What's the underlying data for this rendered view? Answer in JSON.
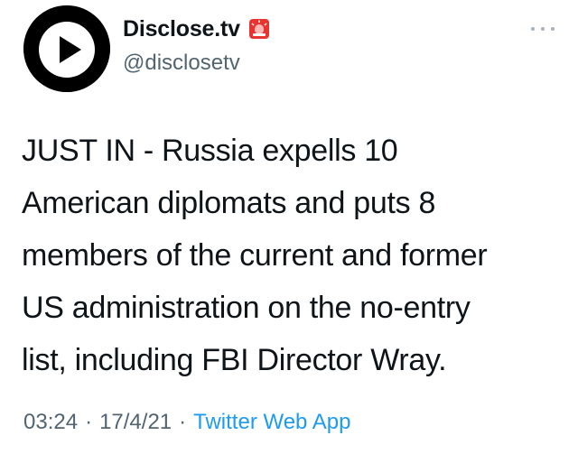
{
  "author": {
    "display_name": "Disclose.tv",
    "handle": "@disclosetv",
    "avatar_icon": "play-button-logo-icon",
    "badge_icon": "siren-emoji-icon"
  },
  "tweet": {
    "text_lines": [
      "JUST IN - Russia expells 10",
      "American diplomats and puts 8",
      "members of the current and former",
      "US administration on the no-entry",
      "list, including FBI Director Wray."
    ]
  },
  "meta": {
    "time": "03:24",
    "date": "17/4/21",
    "separator": "·",
    "source": "Twitter Web App"
  },
  "colors": {
    "text": "#0f1419",
    "secondary": "#536471",
    "link": "#1d9bf0",
    "badge_red": "#e8342f"
  }
}
